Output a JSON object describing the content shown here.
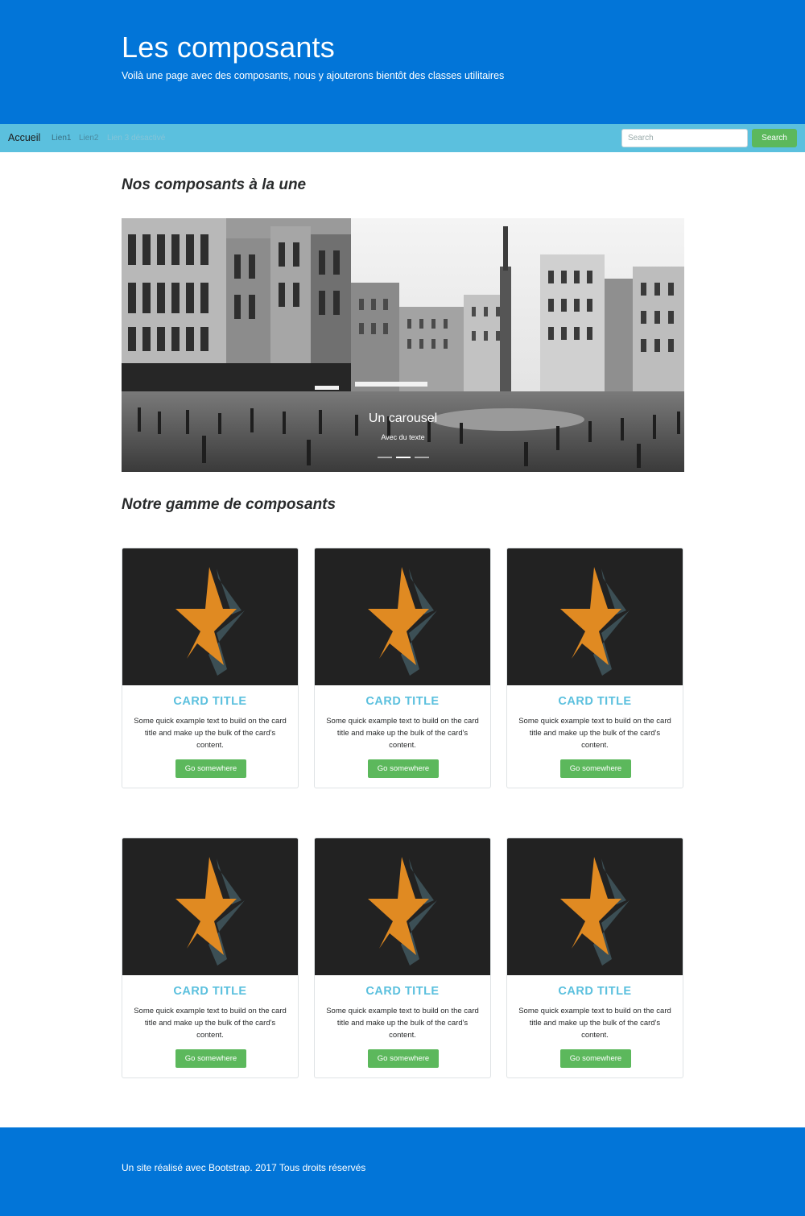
{
  "hero": {
    "title": "Les composants",
    "lead": "Voilà une page avec des composants, nous y ajouterons bientôt des classes utilitaires"
  },
  "navbar": {
    "brand": "Accueil",
    "links": [
      "Lien1",
      "Lien2",
      "Lien 3 désactivé"
    ],
    "search_placeholder": "Search",
    "search_button": "Search"
  },
  "sections": {
    "featured": "Nos composants à la une",
    "range": "Notre gamme de composants"
  },
  "carousel": {
    "caption_title": "Un carousel",
    "caption_text": "Avec du texte",
    "slides_count": 3,
    "active_index": 1
  },
  "cards": [
    {
      "title": "CARD TITLE",
      "text": "Some quick example text to build on the card title and make up the bulk of the card's content.",
      "button": "Go somewhere"
    },
    {
      "title": "CARD TITLE",
      "text": "Some quick example text to build on the card title and make up the bulk of the card's content.",
      "button": "Go somewhere"
    },
    {
      "title": "CARD TITLE",
      "text": "Some quick example text to build on the card title and make up the bulk of the card's content.",
      "button": "Go somewhere"
    },
    {
      "title": "CARD TITLE",
      "text": "Some quick example text to build on the card title and make up the bulk of the card's content.",
      "button": "Go somewhere"
    },
    {
      "title": "CARD TITLE",
      "text": "Some quick example text to build on the card title and make up the bulk of the card's content.",
      "button": "Go somewhere"
    },
    {
      "title": "CARD TITLE",
      "text": "Some quick example text to build on the card title and make up the bulk of the card's content.",
      "button": "Go somewhere"
    }
  ],
  "footer": {
    "text": "Un site réalisé avec Bootstrap. 2017 Tous droits réservés"
  },
  "colors": {
    "primary": "#0275d8",
    "info": "#5bc0de",
    "success": "#5cb85c",
    "star": "#e08a22",
    "star_shadow": "#3c4f55",
    "card_image_bg": "#222222"
  }
}
